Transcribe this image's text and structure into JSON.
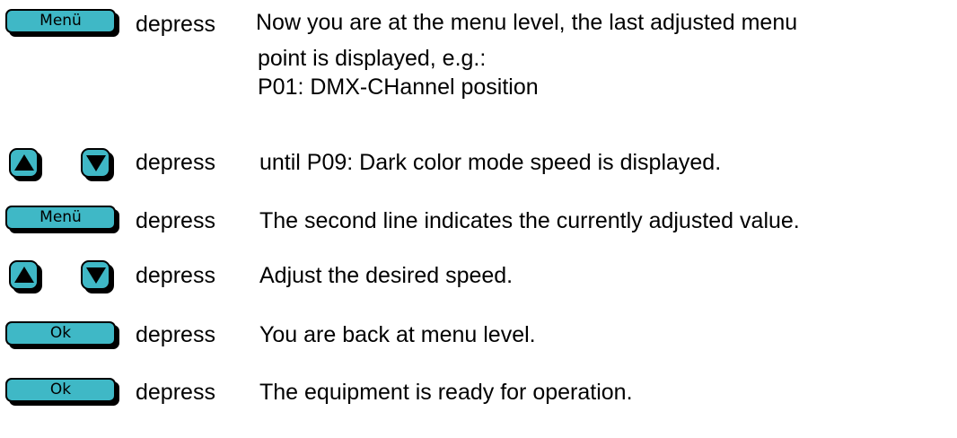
{
  "steps": [
    {
      "key": "Menü",
      "action": "depress",
      "lines": [
        "Now you are at the menu level, the last adjusted menu",
        "point is displayed, e.g.:",
        "P01: DMX-CHannel position"
      ]
    },
    {
      "key_icons": [
        "up-arrow-icon",
        "down-arrow-icon"
      ],
      "action": "depress",
      "text": "until P09: Dark color mode speed is displayed."
    },
    {
      "key": "Menü",
      "action": "depress",
      "text": "The second line indicates the currently adjusted value."
    },
    {
      "key_icons": [
        "up-arrow-icon",
        "down-arrow-icon"
      ],
      "action": "depress",
      "text": "Adjust the desired speed."
    },
    {
      "key": "Ok",
      "action": "depress",
      "text": "You are back at menu level."
    },
    {
      "key": "Ok",
      "action": "depress",
      "text": "The equipment is ready for operation."
    }
  ],
  "colors": {
    "key_fill": "#3fb8c6",
    "key_outline": "#000000"
  }
}
